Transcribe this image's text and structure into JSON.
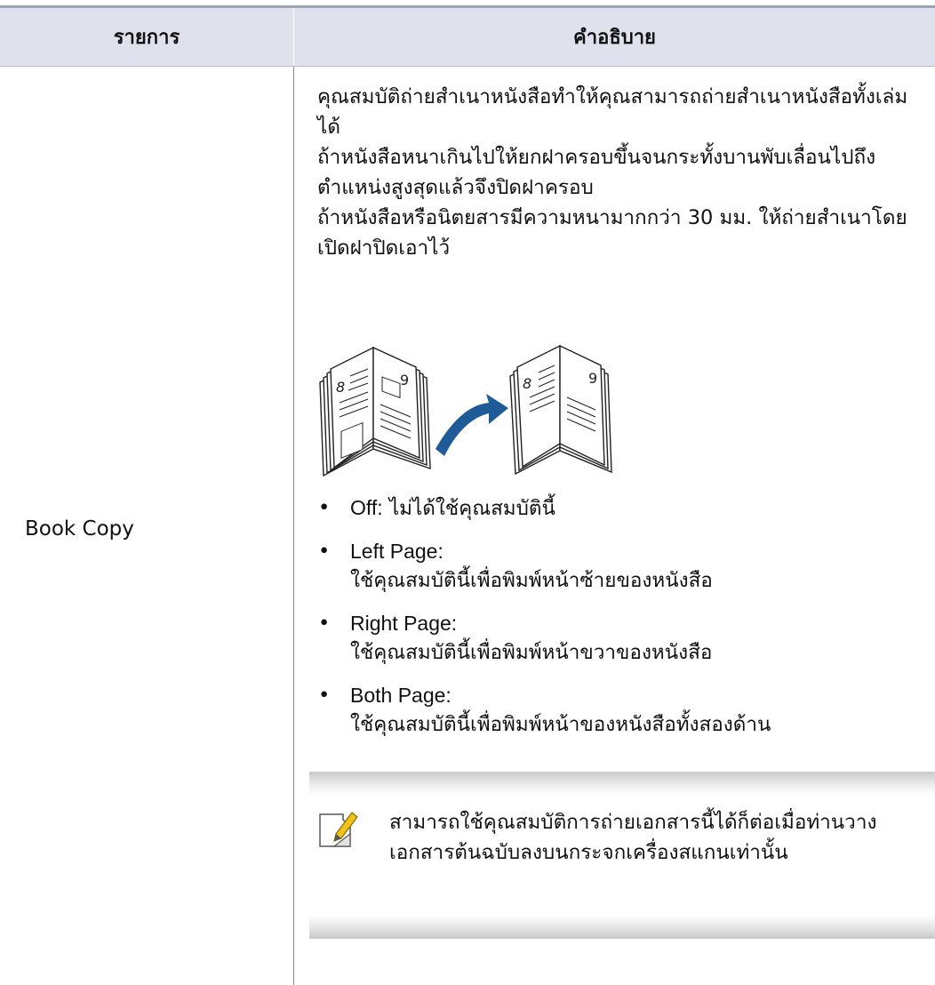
{
  "table": {
    "headers": [
      "รายการ",
      "คำอธิบาย"
    ],
    "rows": [
      {
        "item": "Book Copy",
        "description": {
          "paragraphs": [
            "คุณสมบัติถ่ายสำเนาหนังสือทำให้คุณสามารถถ่ายสำเนาหนังสือทั้งเล่มได้",
            "ถ้าหนังสือหนาเกินไปให้ยกฝาครอบขึ้นจนกระทั้งบานพับเลื่อนไปถึงตำแหน่งสูงสุดแล้วจึงปิดฝาครอบ",
            "ถ้าหนังสือหรือนิตยสารมีความหนามากกว่า 30 มม. ให้ถ่ายสำเนาโดยเปิดฝาปิดเอาไว้"
          ],
          "illustration": {
            "left_book_pages": [
              "8",
              "9"
            ],
            "right_book_pages": [
              "8",
              "9"
            ],
            "arrow_color": "#1f5a99"
          },
          "options": [
            {
              "name": "Off:",
              "text": "ไม่ได้ใช้คุณสมบัตินี้"
            },
            {
              "name": "Left Page:",
              "text": "ใช้คุณสมบัตินี้เพื่อพิมพ์หน้าซ้ายของหนังสือ"
            },
            {
              "name": "Right Page:",
              "text": "ใช้คุณสมบัตินี้เพื่อพิมพ์หน้าขวาของหนังสือ"
            },
            {
              "name": "Both Page:",
              "text": "ใช้คุณสมบัตินี้เพื่อพิมพ์หน้าของหนังสือทั้งสองด้าน"
            }
          ],
          "note": {
            "icon": "note-pencil-icon",
            "text": "สามารถใช้คุณสมบัติการถ่ายเอกสารนี้ได้ก็ต่อเมื่อท่านวางเอกสารต้นฉบับลงบนกระจกเครื่องสแกนเท่านั้น"
          }
        }
      }
    ]
  },
  "colors": {
    "header_bg": "#dfe2ec",
    "top_rule": "#9aa3b8",
    "divider": "#8a8a8a"
  }
}
